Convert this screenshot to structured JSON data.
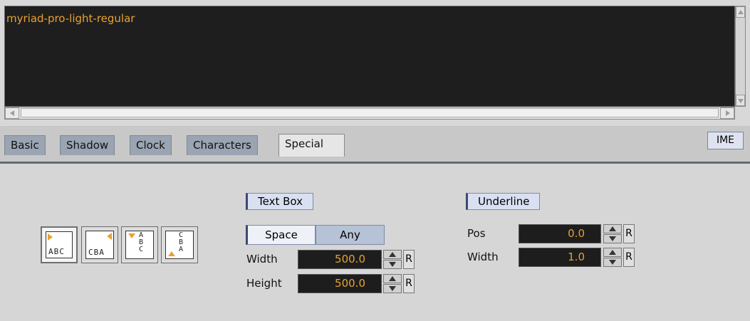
{
  "editor": {
    "text": "myriad-pro-light-regular"
  },
  "tabs": [
    {
      "label": "Basic"
    },
    {
      "label": "Shadow"
    },
    {
      "label": "Clock"
    },
    {
      "label": "Characters"
    },
    {
      "label": "Special",
      "active": true
    }
  ],
  "ime_label": "IME",
  "text_direction": {
    "buttons": [
      {
        "glyph": "ABC",
        "direction": "left-to-right",
        "selected": true
      },
      {
        "glyph": "CBA",
        "direction": "right-to-left",
        "selected": false
      },
      {
        "glyph": "ABC",
        "direction": "top-to-bottom",
        "selected": false
      },
      {
        "glyph": "CBA",
        "direction": "bottom-to-top",
        "selected": false
      }
    ]
  },
  "text_box": {
    "title": "Text Box",
    "mode_options": [
      "Space",
      "Any"
    ],
    "selected_mode": "Space",
    "width_label": "Width",
    "width_value": "500.0",
    "height_label": "Height",
    "height_value": "500.0",
    "reset_label": "R"
  },
  "underline": {
    "title": "Underline",
    "pos_label": "Pos",
    "pos_value": "0.0",
    "width_label": "Width",
    "width_value": "1.0",
    "reset_label": "R"
  },
  "colors": {
    "value_text": "#e8a132",
    "editor_bg": "#1e1e1e",
    "tab_inactive": "#9aa4b2"
  }
}
